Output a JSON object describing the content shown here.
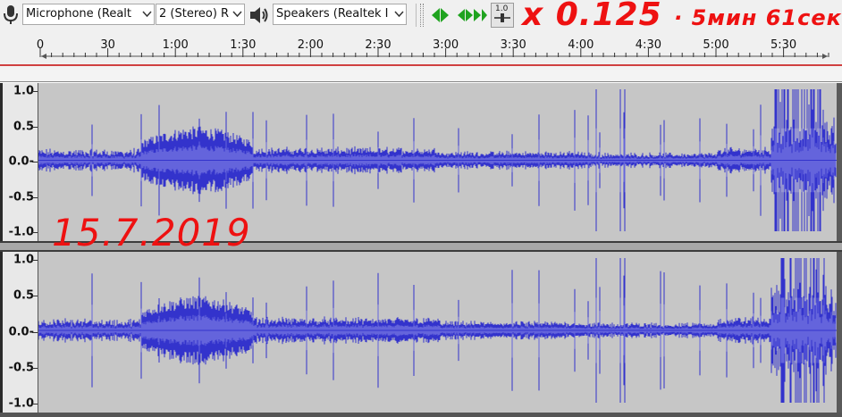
{
  "toolbar": {
    "mic_icon": "microphone-icon",
    "rec_device": "Microphone (Realt",
    "channels": "2 (Stereo) R",
    "speaker_icon": "speaker-icon",
    "play_device": "Speakers (Realtek I",
    "play_at_speed_icon": "play-at-speed-icon",
    "speed_value": "1.0"
  },
  "ruler": {
    "ticks": [
      "0",
      "30",
      "1:00",
      "1:30",
      "2:00",
      "2:30",
      "3:00",
      "3:30",
      "4:00",
      "4:30",
      "5:00",
      "5:30"
    ]
  },
  "tracks": {
    "scale_labels": [
      "1.0",
      "0.5",
      "0.0-",
      "-0.5",
      "-1.0"
    ]
  },
  "annotations": {
    "top": "x 0.125",
    "top_suffix": "· 5мин 61сек",
    "date": "15.7.2019"
  },
  "colors": {
    "waveform": "#3333cc",
    "waveform_rms": "#6464dc",
    "track_background": "#c6c6c6",
    "annotation": "#ee1111"
  }
}
